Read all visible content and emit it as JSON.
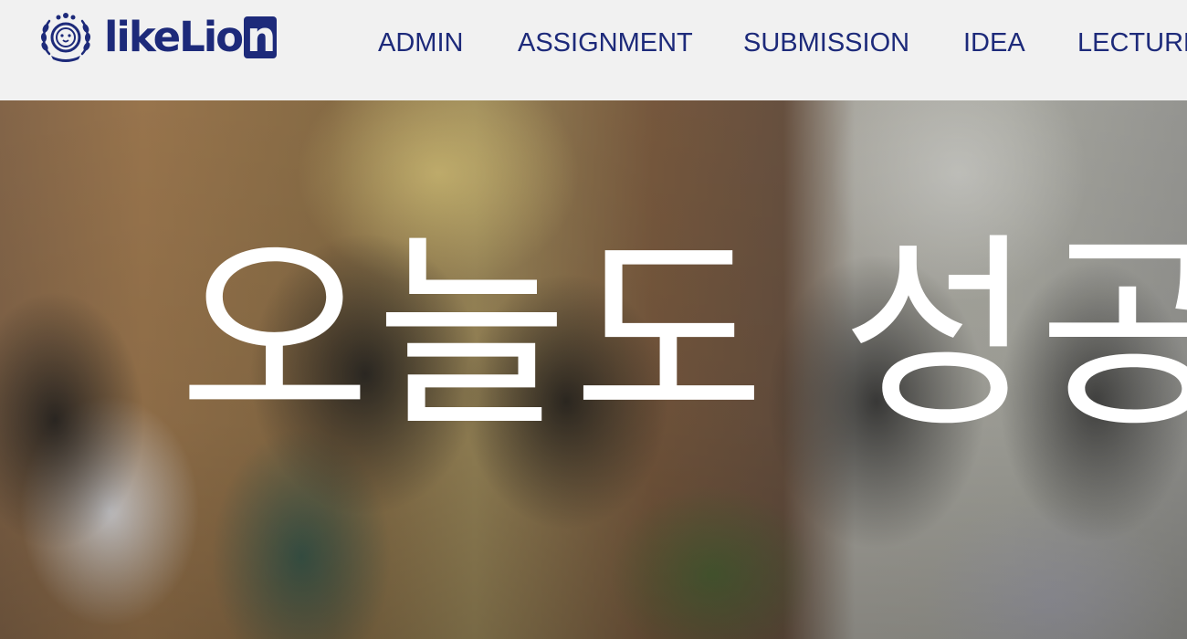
{
  "header": {
    "logo": {
      "text_main": "likeLio",
      "text_box": "n",
      "emblem_icon": "lion-crest-icon"
    },
    "nav": [
      {
        "label": "ADMIN"
      },
      {
        "label": "ASSIGNMENT"
      },
      {
        "label": "SUBMISSION"
      },
      {
        "label": "IDEA"
      },
      {
        "label": "LECTURE"
      }
    ]
  },
  "hero": {
    "title": "오늘도 성공"
  },
  "colors": {
    "brand": "#1d2a7a",
    "header_bg": "#f1f1f1",
    "hero_text": "#ffffff"
  }
}
